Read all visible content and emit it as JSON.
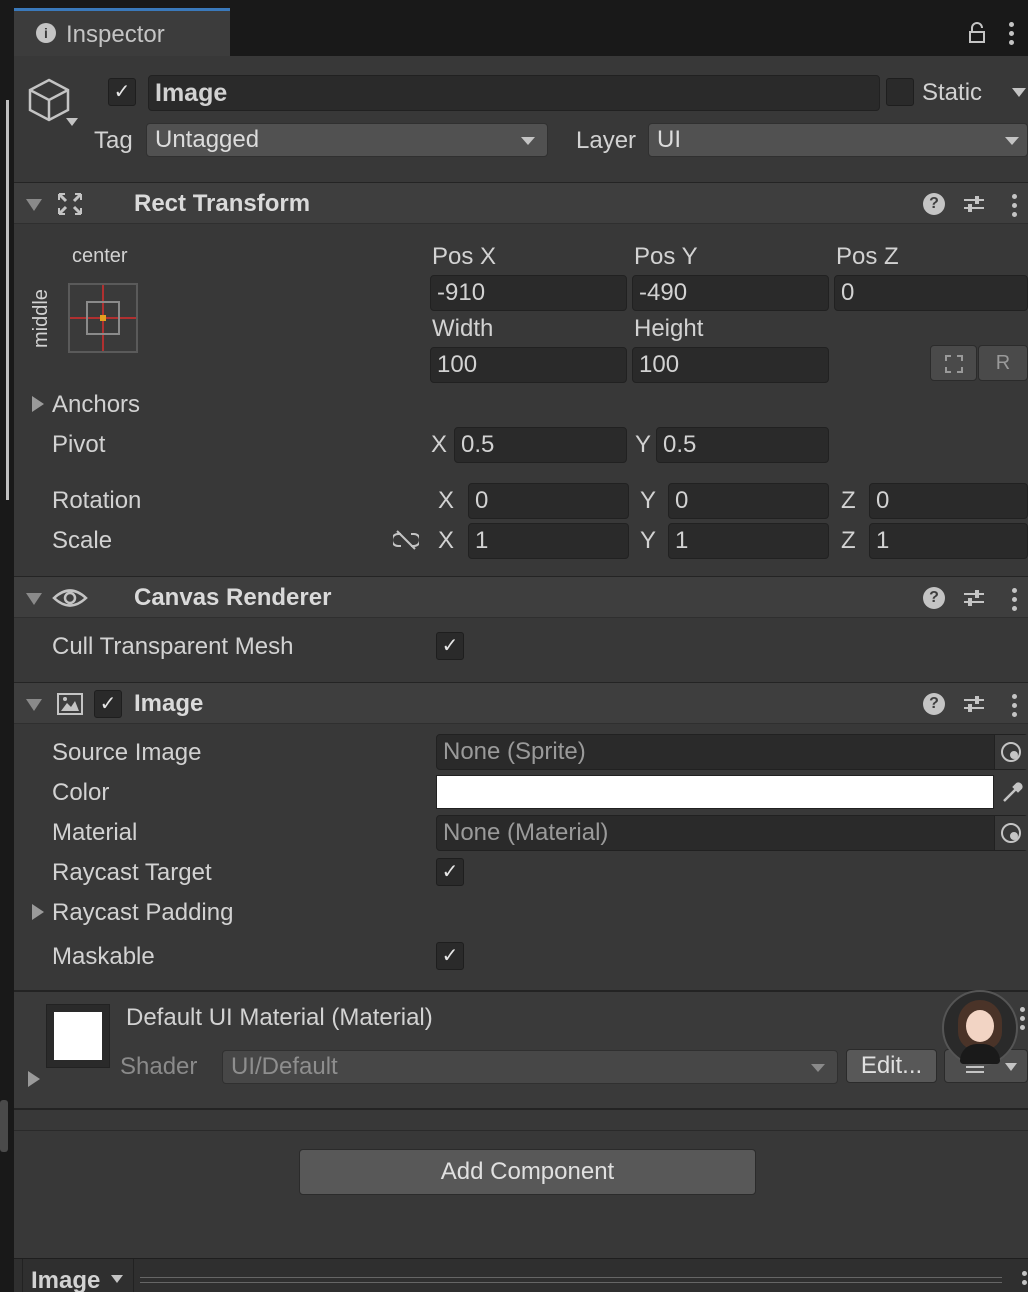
{
  "tab": {
    "label": "Inspector"
  },
  "gameobject": {
    "name": "Image",
    "static_label": "Static",
    "tag_label": "Tag",
    "tag_value": "Untagged",
    "layer_label": "Layer",
    "layer_value": "UI"
  },
  "rect_transform": {
    "title": "Rect Transform",
    "anchor_h": "center",
    "anchor_v": "middle",
    "pos_x_label": "Pos X",
    "pos_y_label": "Pos Y",
    "pos_z_label": "Pos Z",
    "pos_x": "-910",
    "pos_y": "-490",
    "pos_z": "0",
    "width_label": "Width",
    "height_label": "Height",
    "width": "100",
    "height": "100",
    "raw_label": "R",
    "anchors_label": "Anchors",
    "pivot_label": "Pivot",
    "pivot_x": "0.5",
    "pivot_y": "0.5",
    "rotation_label": "Rotation",
    "rot_x": "0",
    "rot_y": "0",
    "rot_z": "0",
    "scale_label": "Scale",
    "scale_x": "1",
    "scale_y": "1",
    "scale_z": "1",
    "x": "X",
    "y": "Y",
    "z": "Z"
  },
  "canvas_renderer": {
    "title": "Canvas Renderer",
    "cull_label": "Cull Transparent Mesh"
  },
  "image": {
    "title": "Image",
    "source_label": "Source Image",
    "source_value": "None (Sprite)",
    "color_label": "Color",
    "color_value": "#ffffff",
    "material_label": "Material",
    "material_value": "None (Material)",
    "raycast_target_label": "Raycast Target",
    "raycast_padding_label": "Raycast Padding",
    "maskable_label": "Maskable"
  },
  "material": {
    "title": "Default UI Material (Material)",
    "shader_label": "Shader",
    "shader_value": "UI/Default",
    "edit_label": "Edit..."
  },
  "add_component_label": "Add Component",
  "footer": {
    "label": "Image"
  },
  "colors": {
    "accent": "#3a79bb",
    "panel": "#383838",
    "field": "#2a2a2a"
  }
}
